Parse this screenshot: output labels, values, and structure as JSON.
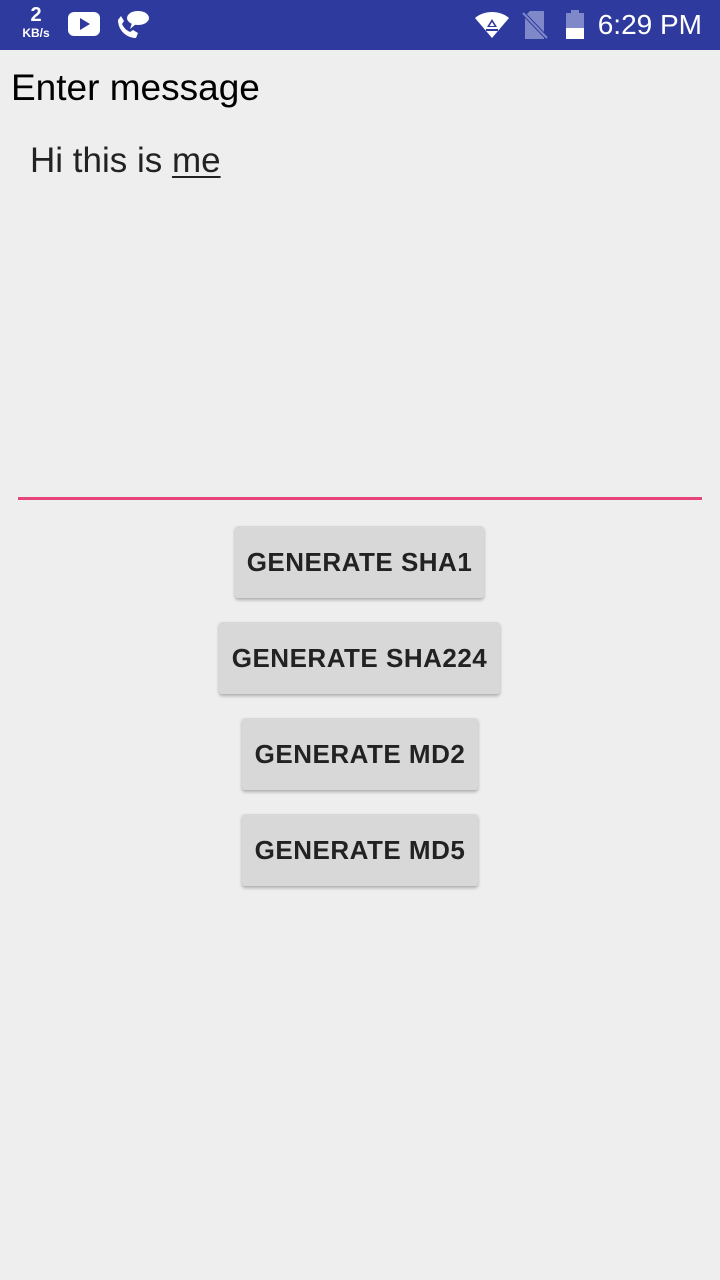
{
  "status_bar": {
    "net_speed_value": "2",
    "net_speed_unit": "KB/s",
    "time": "6:29 PM",
    "icons": [
      "youtube-icon",
      "wifi-call-icon",
      "wifi-icon",
      "no-sim-icon",
      "battery-icon"
    ],
    "bg_color": "#2e3a9e"
  },
  "form": {
    "label": "Enter message",
    "message_prefix": "Hi this is ",
    "message_underlined": "me",
    "accent_color": "#e8447c"
  },
  "buttons": {
    "sha1": "GENERATE SHA1",
    "sha224": "GENERATE SHA224",
    "md2": "GENERATE MD2",
    "md5": "GENERATE MD5"
  }
}
